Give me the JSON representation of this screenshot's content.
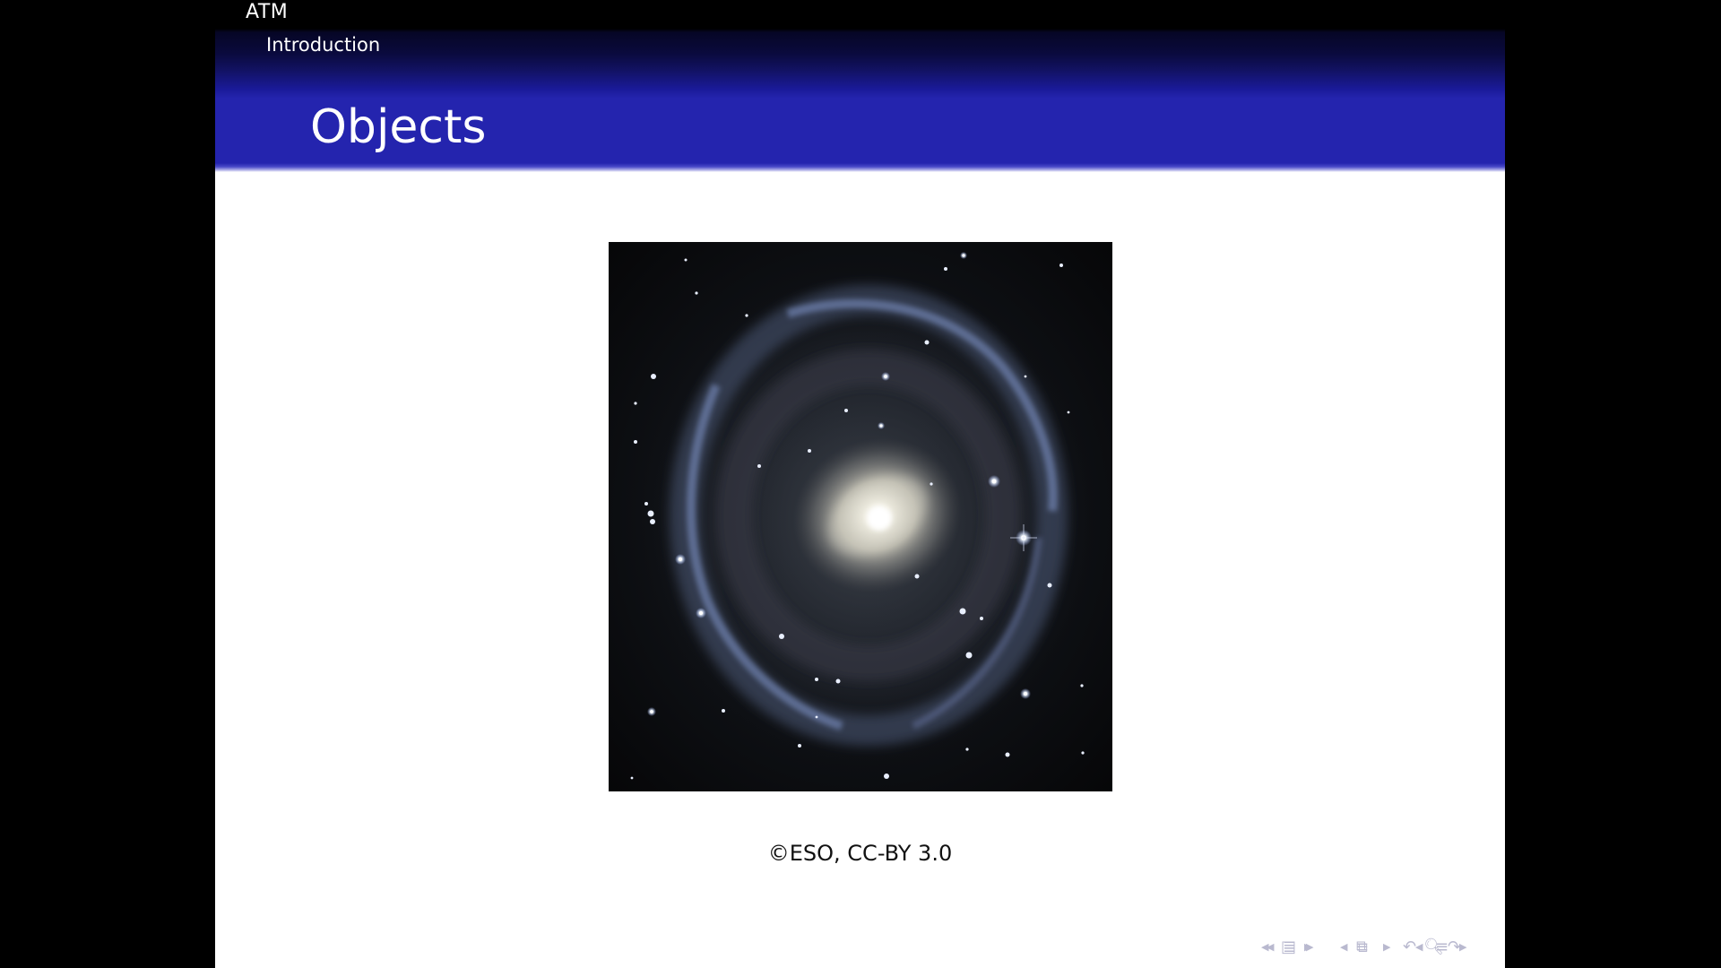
{
  "header": {
    "section": "ATM",
    "subsection": "Introduction"
  },
  "frame": {
    "title": "Objects"
  },
  "figure": {
    "subject": "barred spiral galaxy with outer ring",
    "caption": "©ESO, CC-BY 3.0"
  },
  "navigation": {
    "icons": [
      "prev-arrow-icon",
      "slide-icon",
      "next-arrow-icon",
      "prev-arrow-icon",
      "frame-icon",
      "next-arrow-icon",
      "prev-arrow-icon",
      "subsection-icon",
      "next-arrow-icon",
      "prev-arrow-icon",
      "section-icon",
      "next-arrow-icon",
      "toc-icon",
      "back-icon",
      "search-icon",
      "forward-icon"
    ]
  },
  "colors": {
    "background": "#000000",
    "title_bar": "#2424ae",
    "slide": "#ffffff",
    "nav_icons": "#b9b9cf"
  }
}
